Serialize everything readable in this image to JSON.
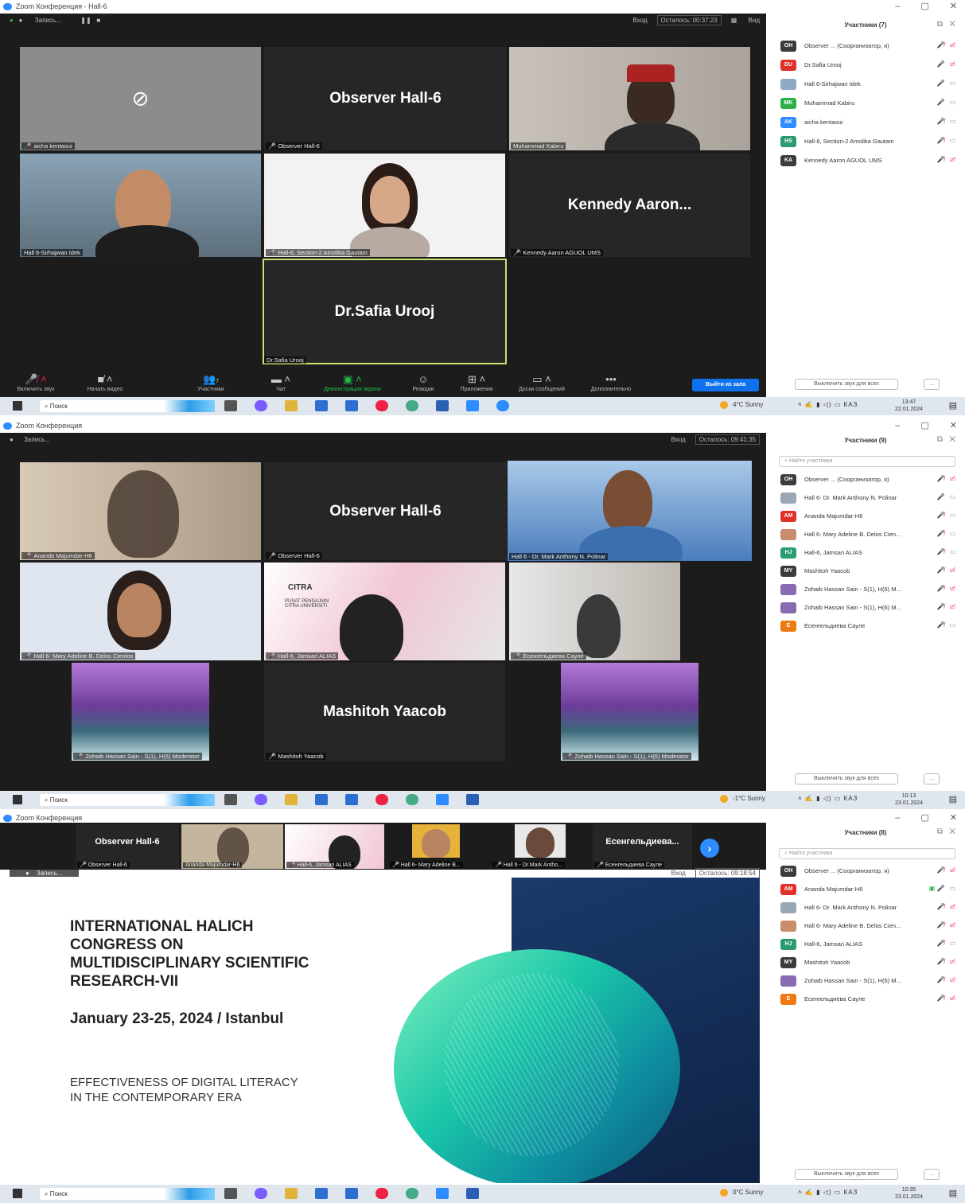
{
  "panel1": {
    "title": "Zoom Конференция - Hall-6",
    "rec_label": "Запись...",
    "top_enter": "Вход",
    "top_remaining": "Осталось: 00:37:23",
    "top_view": "Вид",
    "tiles": [
      {
        "name": "aicha kentaoui",
        "big": ""
      },
      {
        "name": "Observer Hall-6",
        "big": "Observer Hall-6"
      },
      {
        "name": "Muhammad Kabiru",
        "big": ""
      },
      {
        "name": "Hall 6-Sirhajwan Idek",
        "big": ""
      },
      {
        "name": "Hall-6, Section-2 Amolika Gautam",
        "big": ""
      },
      {
        "name": "Kennedy Aaron AGUOL UMS",
        "big": "Kennedy Aaron..."
      },
      {
        "name": "Dr.Safia Urooj",
        "big": "Dr.Safia Urooj"
      }
    ],
    "toolbar": [
      "Включить звук",
      "Начать видео",
      "Участники",
      "Чат",
      "Демонстрация экрана",
      "Реакции",
      "Приложения",
      "Доски сообщений",
      "Дополнительно"
    ],
    "participants_count": "7",
    "leave": "Выйти из зала",
    "side_header": "Участники (7)",
    "participants": [
      {
        "initials": "OH",
        "color": "#3c3c3c",
        "name": "Observer ... (Соорганизатор, я)"
      },
      {
        "initials": "DU",
        "color": "#e0302a",
        "name": "Dr.Safia Urooj"
      },
      {
        "initials": "",
        "color": "#8fa9c8",
        "name": "Hall 6-Sirhajwan Idek"
      },
      {
        "initials": "MK",
        "color": "#2fb14a",
        "name": "Muhammad Kabiru"
      },
      {
        "initials": "AK",
        "color": "#2d8cff",
        "name": "aicha kentaoui"
      },
      {
        "initials": "HS",
        "color": "#2a9c70",
        "name": "Hall-6, Section-2 Amolika Gautam"
      },
      {
        "initials": "KA",
        "color": "#3c3c3c",
        "name": "Kennedy Aaron AGUOL UMS"
      }
    ],
    "mute_all": "Выключить звук для всех",
    "more": "...",
    "weather": "4°C Sunny",
    "lang": "КАЗ",
    "time": "13:47",
    "date": "22.01.2024"
  },
  "panel2": {
    "title": "Zoom Конференция",
    "rec_label": "Запись...",
    "top_enter": "Вход",
    "top_remaining": "Осталось: 09:41:35",
    "tiles": [
      {
        "name": "Ananda Majumdar-H6",
        "big": ""
      },
      {
        "name": "Observer Hall-6",
        "big": "Observer Hall-6"
      },
      {
        "name": "Hall 6 - Dr. Mark Anthony N. Polinar",
        "big": ""
      },
      {
        "name": "Hall 6- Mary Adeline B. Delos Cientos",
        "big": ""
      },
      {
        "name": "Hall-6, Jamsari ALIAS",
        "big": ""
      },
      {
        "name": "Есенгельдиева Сауле",
        "big": ""
      },
      {
        "name": "Zohaib Hassan Sain - S(1), H(6) Moderator",
        "big": ""
      },
      {
        "name": "Mashitoh Yaacob",
        "big": "Mashitoh Yaacob"
      },
      {
        "name": "Zohaib Hassan Sain - S(1), H(6) Moderator",
        "big": ""
      }
    ],
    "citra_label": "CITRA",
    "citra_sub": "PUSAT PENGAJIAN CITRA UNIVERSITI",
    "side_header": "Участники (9)",
    "search_placeholder": "Найти участника",
    "participants": [
      {
        "initials": "OH",
        "color": "#3c3c3c",
        "name": "Observer ... (Соорганизатор, я)"
      },
      {
        "initials": "",
        "color": "#9aa7b5",
        "name": "Hall 6- Dr. Mark Anthony N. Polinar"
      },
      {
        "initials": "AM",
        "color": "#e0302a",
        "name": "Ananda Majumdar-H6"
      },
      {
        "initials": "",
        "color": "#c98d6e",
        "name": "Hall 6- Mary Adeline B. Delos Cien..."
      },
      {
        "initials": "HJ",
        "color": "#2a9c70",
        "name": "Hall-6, Jamsari ALIAS"
      },
      {
        "initials": "MY",
        "color": "#3c3c3c",
        "name": "Mashitoh Yaacob"
      },
      {
        "initials": "",
        "color": "#8a6ab0",
        "name": "Zohaib Hassan Sain - S(1), H(6) M..."
      },
      {
        "initials": "",
        "color": "#8a6ab0",
        "name": "Zohaib Hassan Sain - S(1), H(6) M..."
      },
      {
        "initials": "E",
        "color": "#ee7a12",
        "name": "Есенгельдиева Сауле"
      }
    ],
    "mute_all": "Выключить звук для всех",
    "more": "...",
    "weather": "-1°C Sunny",
    "lang": "КАЗ",
    "time": "10:13",
    "date": "23.01.2024"
  },
  "panel3": {
    "title": "Zoom Конференция",
    "rec_label": "Запись...",
    "top_enter": "Вход",
    "top_remaining": "Осталось: 09:18:54",
    "strip": [
      {
        "name": "Observer Hall-6",
        "big": "Observer Hall-6"
      },
      {
        "name": "Ananda Majumdar-H6",
        "big": ""
      },
      {
        "name": "Hall-6, Jamsari ALIAS",
        "big": ""
      },
      {
        "name": "Hall 6- Mary Adeline B...",
        "big": ""
      },
      {
        "name": "Hall 6 - Dr.Mark Antho...",
        "big": ""
      },
      {
        "name": "Есенгельдиева Сауле",
        "big": "Есенгельдиева..."
      }
    ],
    "slide": {
      "title": "INTERNATIONAL HALICH CONGRESS ON MULTIDISCIPLINARY SCIENTIFIC RESEARCH-VII",
      "dates": "January 23-25, 2024 / Istanbul",
      "subtitle": "EFFECTIVENESS OF DIGITAL LITERACY IN THE CONTEMPORARY ERA"
    },
    "side_header": "Участники (8)",
    "search_placeholder": "Найти участника",
    "participants": [
      {
        "initials": "OH",
        "color": "#3c3c3c",
        "name": "Observer ... (Соорганизатор, я)"
      },
      {
        "initials": "AM",
        "color": "#e0302a",
        "name": "Ananda Majumdar-H6"
      },
      {
        "initials": "",
        "color": "#9aa7b5",
        "name": "Hall 6- Dr. Mark Anthony N. Polinar"
      },
      {
        "initials": "",
        "color": "#c98d6e",
        "name": "Hall 6- Mary Adeline B. Delos Cien..."
      },
      {
        "initials": "HJ",
        "color": "#2a9c70",
        "name": "Hall-6, Jamsari ALIAS"
      },
      {
        "initials": "MY",
        "color": "#3c3c3c",
        "name": "Mashitoh Yaacob"
      },
      {
        "initials": "",
        "color": "#8a6ab0",
        "name": "Zohaib Hassan Sain - S(1), H(6) M..."
      },
      {
        "initials": "E",
        "color": "#ee7a12",
        "name": "Есенгельдиева Сауле"
      }
    ],
    "mute_all": "Выключить звук для всех",
    "more": "...",
    "weather": "0°C Sunny",
    "lang": "КАЗ",
    "time": "10:35",
    "date": "23.01.2024"
  },
  "taskbar": {
    "search": "Поиск"
  }
}
